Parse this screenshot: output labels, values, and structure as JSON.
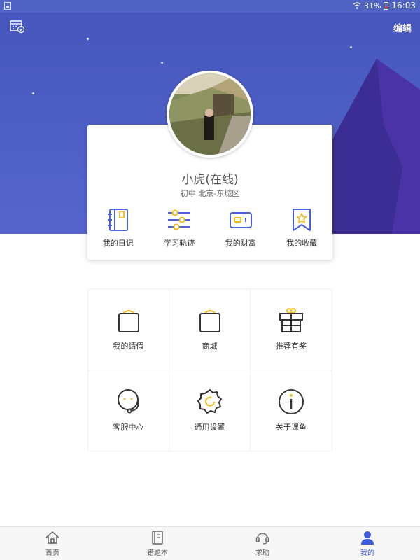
{
  "status_bar": {
    "battery": "31%",
    "time": "16:03"
  },
  "header": {
    "edit_label": "编辑"
  },
  "profile": {
    "name": "小虎(在线)",
    "info": "初中  北京-东城区",
    "quick_links": [
      {
        "label": "我的日记",
        "icon": "diary-icon"
      },
      {
        "label": "学习轨迹",
        "icon": "sliders-icon"
      },
      {
        "label": "我的财富",
        "icon": "wallet-icon"
      },
      {
        "label": "我的收藏",
        "icon": "bookmark-star-icon"
      }
    ]
  },
  "menu": [
    {
      "label": "我的请假",
      "icon": "bag-icon"
    },
    {
      "label": "商城",
      "icon": "shopping-bag-icon"
    },
    {
      "label": "推荐有奖",
      "icon": "gift-icon"
    },
    {
      "label": "客服中心",
      "icon": "headset-icon"
    },
    {
      "label": "通用设置",
      "icon": "gear-icon"
    },
    {
      "label": "关于课鱼",
      "icon": "info-icon"
    }
  ],
  "bottom_nav": [
    {
      "label": "首页",
      "icon": "home-icon"
    },
    {
      "label": "错题本",
      "icon": "notebook-icon"
    },
    {
      "label": "求助",
      "icon": "help-headset-icon"
    },
    {
      "label": "我的",
      "icon": "user-icon",
      "active": true
    }
  ],
  "colors": {
    "accent": "#3d5bd9",
    "header_bg": "#4c5ec4",
    "icon_yellow": "#f5b91a",
    "icon_dark": "#333333"
  }
}
